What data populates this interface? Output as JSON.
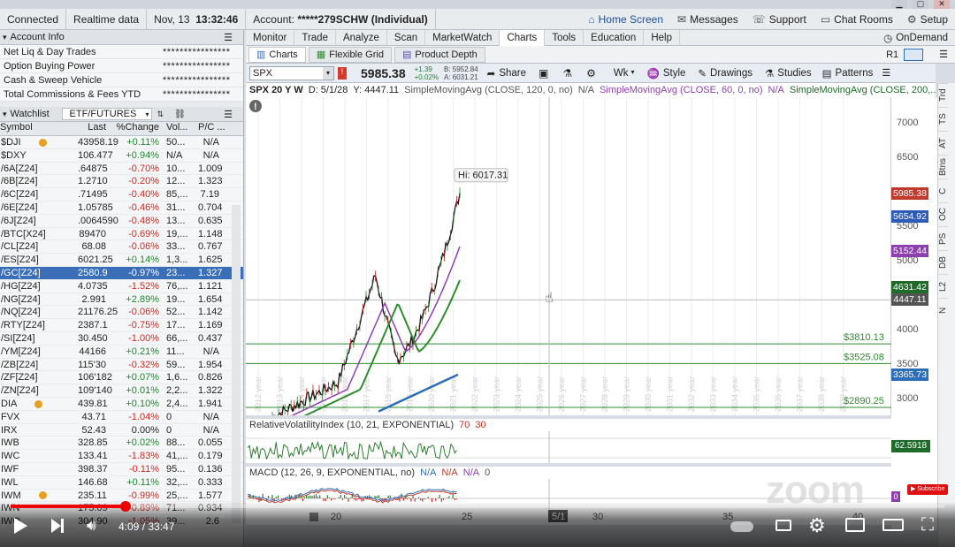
{
  "topbar": {
    "connection": "Connected",
    "realtime": "Realtime data",
    "date": "Nov, 13",
    "time": "13:32:46",
    "account_label": "Account:",
    "account_value": "*****279SCHW (Individual)",
    "home_screen": "Home Screen",
    "messages": "Messages",
    "support": "Support",
    "chat_rooms": "Chat Rooms",
    "setup": "Setup"
  },
  "account_info": {
    "title": "Account Info",
    "rows": [
      {
        "label": "Net Liq & Day Trades",
        "value": "****************"
      },
      {
        "label": "Option Buying Power",
        "value": "****************"
      },
      {
        "label": "Cash & Sweep Vehicle",
        "value": "****************"
      },
      {
        "label": "Total Commissions & Fees YTD",
        "value": "****************"
      }
    ]
  },
  "watchlist": {
    "title": "Watchlist",
    "list_name": "ETF/FUTURES",
    "columns": [
      "Symbol",
      "Last",
      "%Change",
      "Vol...",
      "P/C ..."
    ],
    "rows": [
      {
        "sym": "$DJI",
        "last": "43958.19",
        "chg": "+0.11%",
        "vol": "50...",
        "pc": "N/A",
        "dir": "pos"
      },
      {
        "sym": "$DXY",
        "last": "106.477",
        "chg": "+0.94%",
        "vol": "N/A",
        "pc": "N/A",
        "dir": "pos"
      },
      {
        "sym": "/6A[Z24]",
        "last": ".64875",
        "chg": "-0.70%",
        "vol": "10...",
        "pc": "1.009",
        "dir": "neg"
      },
      {
        "sym": "/6B[Z24]",
        "last": "1.2710",
        "chg": "-0.20%",
        "vol": "12...",
        "pc": "1.323",
        "dir": "neg"
      },
      {
        "sym": "/6C[Z24]",
        "last": ".71495",
        "chg": "-0.40%",
        "vol": "85,...",
        "pc": "7.19",
        "dir": "neg"
      },
      {
        "sym": "/6E[Z24]",
        "last": "1.05785",
        "chg": "-0.46%",
        "vol": "31...",
        "pc": "0.704",
        "dir": "neg"
      },
      {
        "sym": "/6J[Z24]",
        "last": ".0064590",
        "chg": "-0.48%",
        "vol": "13...",
        "pc": "0.635",
        "dir": "neg"
      },
      {
        "sym": "/BTC[X24]",
        "last": "89470",
        "chg": "-0.69%",
        "vol": "19,...",
        "pc": "1.148",
        "dir": "neg"
      },
      {
        "sym": "/CL[Z24]",
        "last": "68.08",
        "chg": "-0.06%",
        "vol": "33...",
        "pc": "0.767",
        "dir": "neg"
      },
      {
        "sym": "/ES[Z24]",
        "last": "6021.25",
        "chg": "+0.14%",
        "vol": "1,3...",
        "pc": "1.625",
        "dir": "pos"
      },
      {
        "sym": "/GC[Z24]",
        "last": "2580.9",
        "chg": "-0.97%",
        "vol": "23...",
        "pc": "1.327",
        "dir": "neg"
      },
      {
        "sym": "/HG[Z24]",
        "last": "4.0735",
        "chg": "-1.52%",
        "vol": "76,...",
        "pc": "1.121",
        "dir": "neg"
      },
      {
        "sym": "/NG[Z24]",
        "last": "2.991",
        "chg": "+2.89%",
        "vol": "19...",
        "pc": "1.654",
        "dir": "pos"
      },
      {
        "sym": "/NQ[Z24]",
        "last": "21176.25",
        "chg": "-0.06%",
        "vol": "52...",
        "pc": "1.142",
        "dir": "neg"
      },
      {
        "sym": "/RTY[Z24]",
        "last": "2387.1",
        "chg": "-0.75%",
        "vol": "17...",
        "pc": "1.169",
        "dir": "neg"
      },
      {
        "sym": "/SI[Z24]",
        "last": "30.450",
        "chg": "-1.00%",
        "vol": "66,...",
        "pc": "0.437",
        "dir": "neg"
      },
      {
        "sym": "/YM[Z24]",
        "last": "44166",
        "chg": "+0.21%",
        "vol": "11...",
        "pc": "N/A",
        "dir": "pos"
      },
      {
        "sym": "/ZB[Z24]",
        "last": "115'30",
        "chg": "-0.32%",
        "vol": "59...",
        "pc": "1.954",
        "dir": "neg"
      },
      {
        "sym": "/ZF[Z24]",
        "last": "106'182",
        "chg": "+0.07%",
        "vol": "1,6...",
        "pc": "0.826",
        "dir": "pos"
      },
      {
        "sym": "/ZN[Z24]",
        "last": "109'140",
        "chg": "+0.01%",
        "vol": "2,2...",
        "pc": "1.322",
        "dir": "pos"
      },
      {
        "sym": "DIA",
        "last": "439.81",
        "chg": "+0.10%",
        "vol": "2,4...",
        "pc": "1.941",
        "dir": "pos"
      },
      {
        "sym": "FVX",
        "last": "43.71",
        "chg": "-1.04%",
        "vol": "0",
        "pc": "N/A",
        "dir": "neg"
      },
      {
        "sym": "IRX",
        "last": "52.43",
        "chg": "0.00%",
        "vol": "0",
        "pc": "N/A",
        "dir": "none"
      },
      {
        "sym": "IWB",
        "last": "328.85",
        "chg": "+0.02%",
        "vol": "88...",
        "pc": "0.055",
        "dir": "pos"
      },
      {
        "sym": "IWC",
        "last": "133.41",
        "chg": "-1.83%",
        "vol": "41,...",
        "pc": "0.179",
        "dir": "neg"
      },
      {
        "sym": "IWF",
        "last": "398.37",
        "chg": "-0.11%",
        "vol": "95...",
        "pc": "0.136",
        "dir": "neg"
      },
      {
        "sym": "IWL",
        "last": "146.68",
        "chg": "+0.11%",
        "vol": "32,...",
        "pc": "0.333",
        "dir": "pos"
      },
      {
        "sym": "IWM",
        "last": "235.11",
        "chg": "-0.99%",
        "vol": "25,...",
        "pc": "1.577",
        "dir": "neg"
      },
      {
        "sym": "IWN",
        "last": "175.09",
        "chg": "-0.89%",
        "vol": "71...",
        "pc": "0.934",
        "dir": "neg"
      },
      {
        "sym": "IWO",
        "last": "304.90",
        "chg": "-1.05%",
        "vol": "39...",
        "pc": "2.6",
        "dir": "neg"
      }
    ],
    "selected_index": 10
  },
  "mainnav": {
    "tabs": [
      "Monitor",
      "Trade",
      "Analyze",
      "Scan",
      "MarketWatch",
      "Charts",
      "Tools",
      "Education",
      "Help"
    ],
    "active": "Charts",
    "ondemand": "OnDemand"
  },
  "subnav": {
    "tabs": [
      "Charts",
      "Flexible Grid",
      "Product Depth"
    ],
    "active": "Charts",
    "r1": "R1"
  },
  "toolbar": {
    "symbol": "SPX",
    "price": "5985.38",
    "change": "+1.39",
    "change_pct": "+0.02%",
    "bid": "B: 5952.84",
    "ask": "A: 6031.21",
    "share": "Share",
    "wk": "Wk",
    "style": "Style",
    "drawings": "Drawings",
    "studies": "Studies",
    "patterns": "Patterns"
  },
  "charthead": {
    "title": "SPX 20 Y W",
    "date": "D: 5/1/28",
    "y": "Y: 4447.11",
    "sma120": "SimpleMovingAvg (CLOSE, 120, 0, no)",
    "na1": "N/A",
    "sma60": "SimpleMovingAvg (CLOSE, 60, 0, no)",
    "na2": "N/A",
    "sma200": "SimpleMovingAvg (CLOSE, 200,..."
  },
  "price_chart": {
    "hi_label": "Hi: 6017.31",
    "y_ticks": [
      "7000",
      "6500",
      "6000",
      "5500",
      "5000",
      "4500",
      "4000",
      "3500",
      "3000"
    ],
    "levels": [
      {
        "value": "$3810.13",
        "color": "#2e8b2e"
      },
      {
        "value": "$3525.08",
        "color": "#2e8b2e"
      },
      {
        "value": "$2890.25",
        "color": "#2e8b2e"
      }
    ],
    "price_tags": [
      {
        "value": "5985.38",
        "color": "#c0392b"
      },
      {
        "value": "5654.92",
        "color": "#2c5bb8"
      },
      {
        "value": "5152.44",
        "color": "#8e3fae"
      },
      {
        "value": "4631.42",
        "color": "#1f6b2a"
      },
      {
        "value": "4447.11",
        "color": "#555"
      },
      {
        "value": "3365.73",
        "color": "#2c6fb8"
      }
    ],
    "year_labels": [
      "2012 year",
      "2013 year",
      "2014 year",
      "2015 year",
      "2016 year",
      "2017 year",
      "2018 year",
      "2019 year",
      "2020 year",
      "2021 year",
      "2022 year",
      "2023 year",
      "2024 year",
      "2025 year",
      "2026 year",
      "2027 year",
      "2028 year",
      "2029 year",
      "2030 year",
      "2031 year",
      "2032 year",
      "2033 year",
      "2034 year",
      "2035 year",
      "2036 year",
      "2037 year",
      "2038 year",
      "2039 year"
    ]
  },
  "rvi": {
    "label": "RelativeVolatilityIndex (10, 21, EXPONENTIAL)",
    "v1": "70",
    "v2": "30",
    "value": "62.5918"
  },
  "macd": {
    "label": "MACD (12, 26, 9, EXPONENTIAL, no)",
    "na1": "N/A",
    "na2": "N/A",
    "na3": "N/A",
    "zero": "0",
    "tag": "0"
  },
  "xaxis": {
    "labels": [
      "20",
      "25",
      "5/1",
      "30",
      "35",
      "40"
    ]
  },
  "rightbar": {
    "items": [
      "Trd",
      "TS",
      "AT",
      "Btns",
      "C",
      "OC",
      "PS",
      "DB",
      "L2",
      "N"
    ]
  },
  "player": {
    "time": "4:09 / 33:47",
    "progress": 0.123
  },
  "watermark": "zoom"
}
